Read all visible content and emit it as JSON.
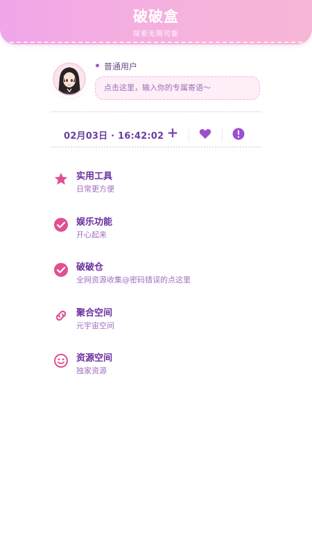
{
  "header": {
    "title": "破破盒",
    "subtitle": "探索无限可能"
  },
  "profile": {
    "user_type": "普通用户",
    "motto_placeholder": "点击这里，输入你的专属寄语～"
  },
  "status": {
    "datetime": "02月03日 · 16:42:02",
    "add_label": "+"
  },
  "menu": {
    "items": [
      {
        "title": "实用工具",
        "desc": "日常更方便",
        "icon": "star-icon"
      },
      {
        "title": "娱乐功能",
        "desc": "开心起来",
        "icon": "check-circle-icon"
      },
      {
        "title": "破破仓",
        "desc": "全网资源收集@密码错误的点这里",
        "icon": "check-circle-icon"
      },
      {
        "title": "聚合空间",
        "desc": "元宇宙空间",
        "icon": "link-icon"
      },
      {
        "title": "资源空间",
        "desc": "独家资源",
        "icon": "smiley-icon"
      }
    ]
  },
  "colors": {
    "header_gradient_start": "#f0a6e8",
    "header_gradient_end": "#f7b6d6",
    "title_purple": "#6a2fa0",
    "icon_pink": "#e0508f",
    "accent_purple": "#9b59c9"
  }
}
